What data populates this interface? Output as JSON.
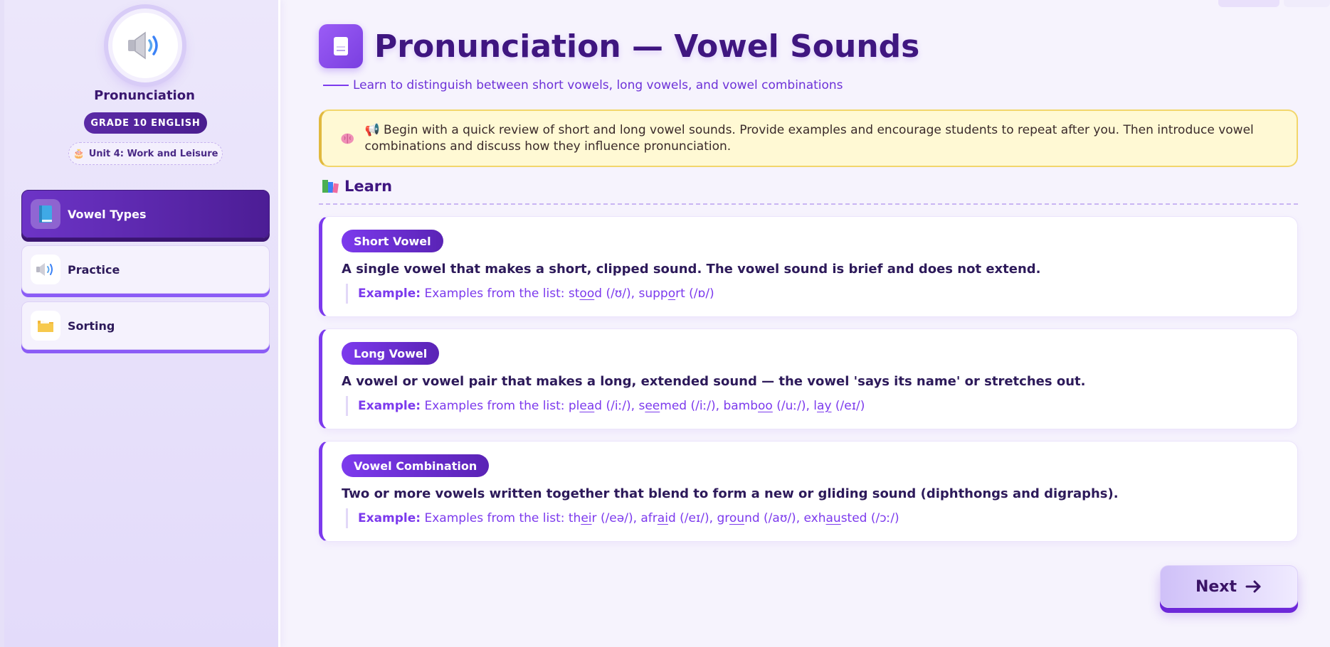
{
  "sidebar": {
    "app_name": "Pronunciation",
    "grade": "GRADE 10 ENGLISH",
    "unit_emoji": "🎂",
    "unit": "Unit 4: Work and Leisure",
    "items": [
      {
        "label": "Vowel Types",
        "icon": "book-icon",
        "active": true
      },
      {
        "label": "Practice",
        "icon": "speaker-icon",
        "active": false
      },
      {
        "label": "Sorting",
        "icon": "folder-icon",
        "active": false
      }
    ]
  },
  "header": {
    "title": "Pronunciation — Vowel Sounds",
    "subtitle": "Learn to distinguish between short vowels, long vowels, and vowel combinations"
  },
  "notice": {
    "emoji": "📢",
    "text": "Begin with a quick review of short and long vowel sounds. Provide examples and encourage students to repeat after you. Then introduce vowel combinations and discuss how they influence pronunciation."
  },
  "section": {
    "label": "Learn"
  },
  "cards": [
    {
      "tag": "Short Vowel",
      "definition": "A single vowel that makes a short, clipped sound. The vowel sound is brief and does not extend.",
      "example_label": "Example:",
      "example_prefix": "Examples from the list:",
      "examples": [
        {
          "pre": "st",
          "focus": "oo",
          "post": "d",
          "ipa": "(/ʊ/)"
        },
        {
          "pre": "supp",
          "focus": "o",
          "post": "rt",
          "ipa": "(/ɒ/)"
        }
      ]
    },
    {
      "tag": "Long Vowel",
      "definition": "A vowel or vowel pair that makes a long, extended sound — the vowel 'says its name' or stretches out.",
      "example_label": "Example:",
      "example_prefix": "Examples from the list:",
      "examples": [
        {
          "pre": "pl",
          "focus": "ea",
          "post": "d",
          "ipa": "(/iː/)"
        },
        {
          "pre": "s",
          "focus": "ee",
          "post": "med",
          "ipa": "(/iː/)"
        },
        {
          "pre": "bamb",
          "focus": "oo",
          "post": "",
          "ipa": "(/uː/)"
        },
        {
          "pre": "l",
          "focus": "ay",
          "post": "",
          "ipa": "(/eɪ/)"
        }
      ]
    },
    {
      "tag": "Vowel Combination",
      "definition": "Two or more vowels written together that blend to form a new or gliding sound (diphthongs and digraphs).",
      "example_label": "Example:",
      "example_prefix": "Examples from the list:",
      "examples": [
        {
          "pre": "th",
          "focus": "ei",
          "post": "r",
          "ipa": "(/eə/)"
        },
        {
          "pre": "afr",
          "focus": "ai",
          "post": "d",
          "ipa": "(/eɪ/)"
        },
        {
          "pre": "gr",
          "focus": "ou",
          "post": "nd",
          "ipa": "(/aʊ/)"
        },
        {
          "pre": "exh",
          "focus": "au",
          "post": "sted",
          "ipa": "(/ɔː/)"
        }
      ]
    }
  ],
  "footer": {
    "next_label": "Next"
  },
  "colors": {
    "accent": "#7c3aed",
    "accent_dark": "#4c1d95",
    "notice_bg": "#fff9d4",
    "page_bg": "#f6f3fd"
  }
}
